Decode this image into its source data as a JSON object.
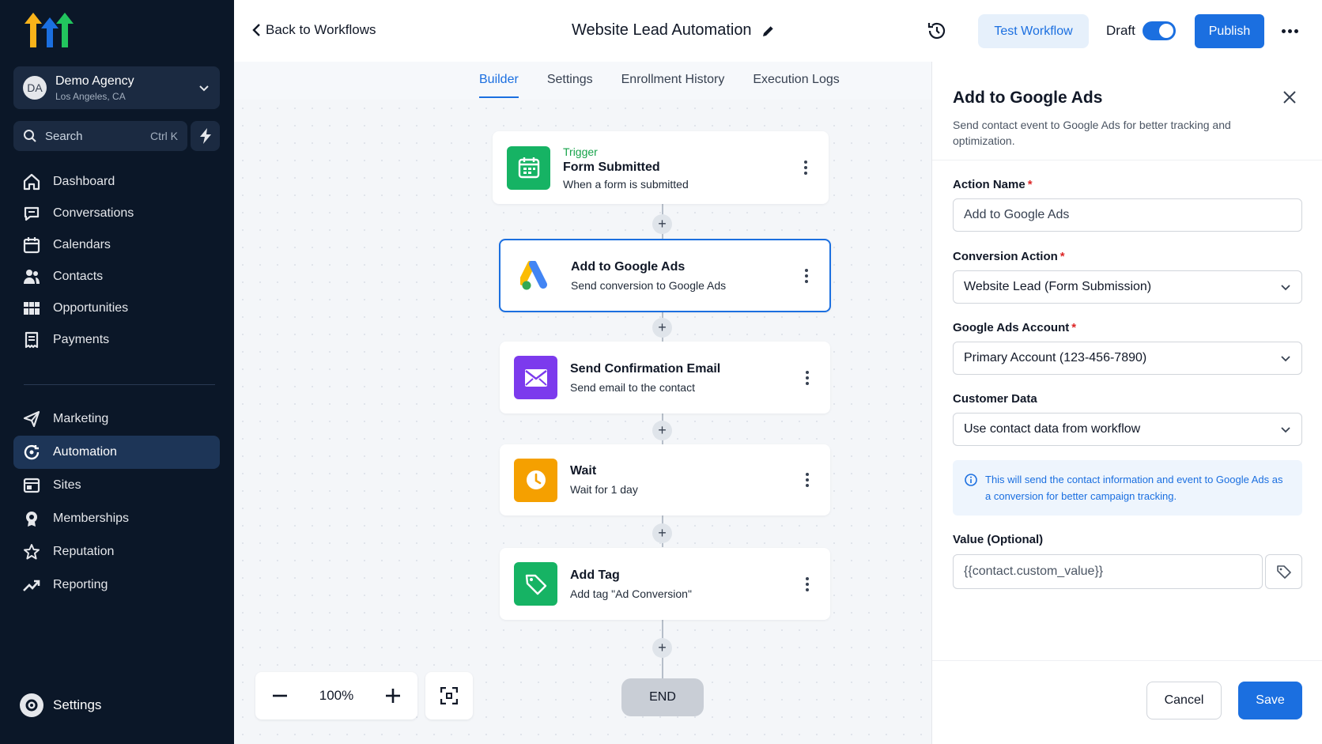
{
  "sidebar": {
    "account": {
      "initials": "DA",
      "name": "Demo Agency",
      "location": "Los Angeles, CA"
    },
    "search": {
      "label": "Search",
      "shortcut": "Ctrl K"
    },
    "nav_primary": [
      {
        "label": "Dashboard",
        "icon": "home-icon"
      },
      {
        "label": "Conversations",
        "icon": "chat-icon"
      },
      {
        "label": "Calendars",
        "icon": "calendar-icon"
      },
      {
        "label": "Contacts",
        "icon": "contacts-icon"
      },
      {
        "label": "Opportunities",
        "icon": "opportunities-icon"
      },
      {
        "label": "Payments",
        "icon": "payments-icon"
      }
    ],
    "nav_secondary": [
      {
        "label": "Marketing",
        "icon": "send-icon"
      },
      {
        "label": "Automation",
        "icon": "automation-icon",
        "active": true
      },
      {
        "label": "Sites",
        "icon": "sites-icon"
      },
      {
        "label": "Memberships",
        "icon": "memberships-icon"
      },
      {
        "label": "Reputation",
        "icon": "star-icon"
      },
      {
        "label": "Reporting",
        "icon": "trend-icon"
      }
    ],
    "settings_label": "Settings"
  },
  "header": {
    "back_label": "Back to Workflows",
    "workflow_title": "Website Lead Automation",
    "test_label": "Test Workflow",
    "draft_label": "Draft",
    "draft_enabled": true,
    "publish_label": "Publish"
  },
  "tabs": [
    {
      "label": "Builder",
      "active": true
    },
    {
      "label": "Settings"
    },
    {
      "label": "Enrollment History"
    },
    {
      "label": "Execution Logs"
    }
  ],
  "workflow": {
    "nodes": [
      {
        "kicker": "Trigger",
        "title": "Form Submitted",
        "subtitle": "When a form is submitted",
        "icon": "calendar-form-icon",
        "color": "#16b364"
      },
      {
        "title": "Add to Google Ads",
        "subtitle": "Send conversion to Google Ads",
        "icon": "google-ads-icon",
        "selected": true
      },
      {
        "title": "Send Confirmation Email",
        "subtitle": "Send email to the contact",
        "icon": "email-icon",
        "color": "#7c3aed"
      },
      {
        "title": "Wait",
        "subtitle": "Wait for 1 day",
        "icon": "clock-icon",
        "color": "#f5a000"
      },
      {
        "title": "Add Tag",
        "subtitle": "Add tag \"Ad Conversion\"",
        "icon": "tag-icon",
        "color": "#16b364"
      }
    ],
    "end_label": "END",
    "zoom_label": "100%"
  },
  "panel": {
    "title": "Add to Google Ads",
    "description": "Send contact event to Google Ads for better tracking and optimization.",
    "action_name_label": "Action Name",
    "action_name_value": "Add to Google Ads",
    "conversion_label": "Conversion Action",
    "conversion_value": "Website Lead (Form Submission)",
    "account_label": "Google Ads Account",
    "account_value": "Primary Account (123-456-7890)",
    "customer_label": "Customer Data",
    "customer_value": "Use contact data from workflow",
    "info_text": "This will send the contact information and event to Google Ads as a conversion for better campaign tracking.",
    "value_label": "Value (Optional)",
    "value_value": "{{contact.custom_value}}",
    "cancel_label": "Cancel",
    "save_label": "Save"
  },
  "colors": {
    "accent": "#1b6fe0",
    "sidebar": "#0b1728",
    "active_nav": "#1d3557"
  }
}
